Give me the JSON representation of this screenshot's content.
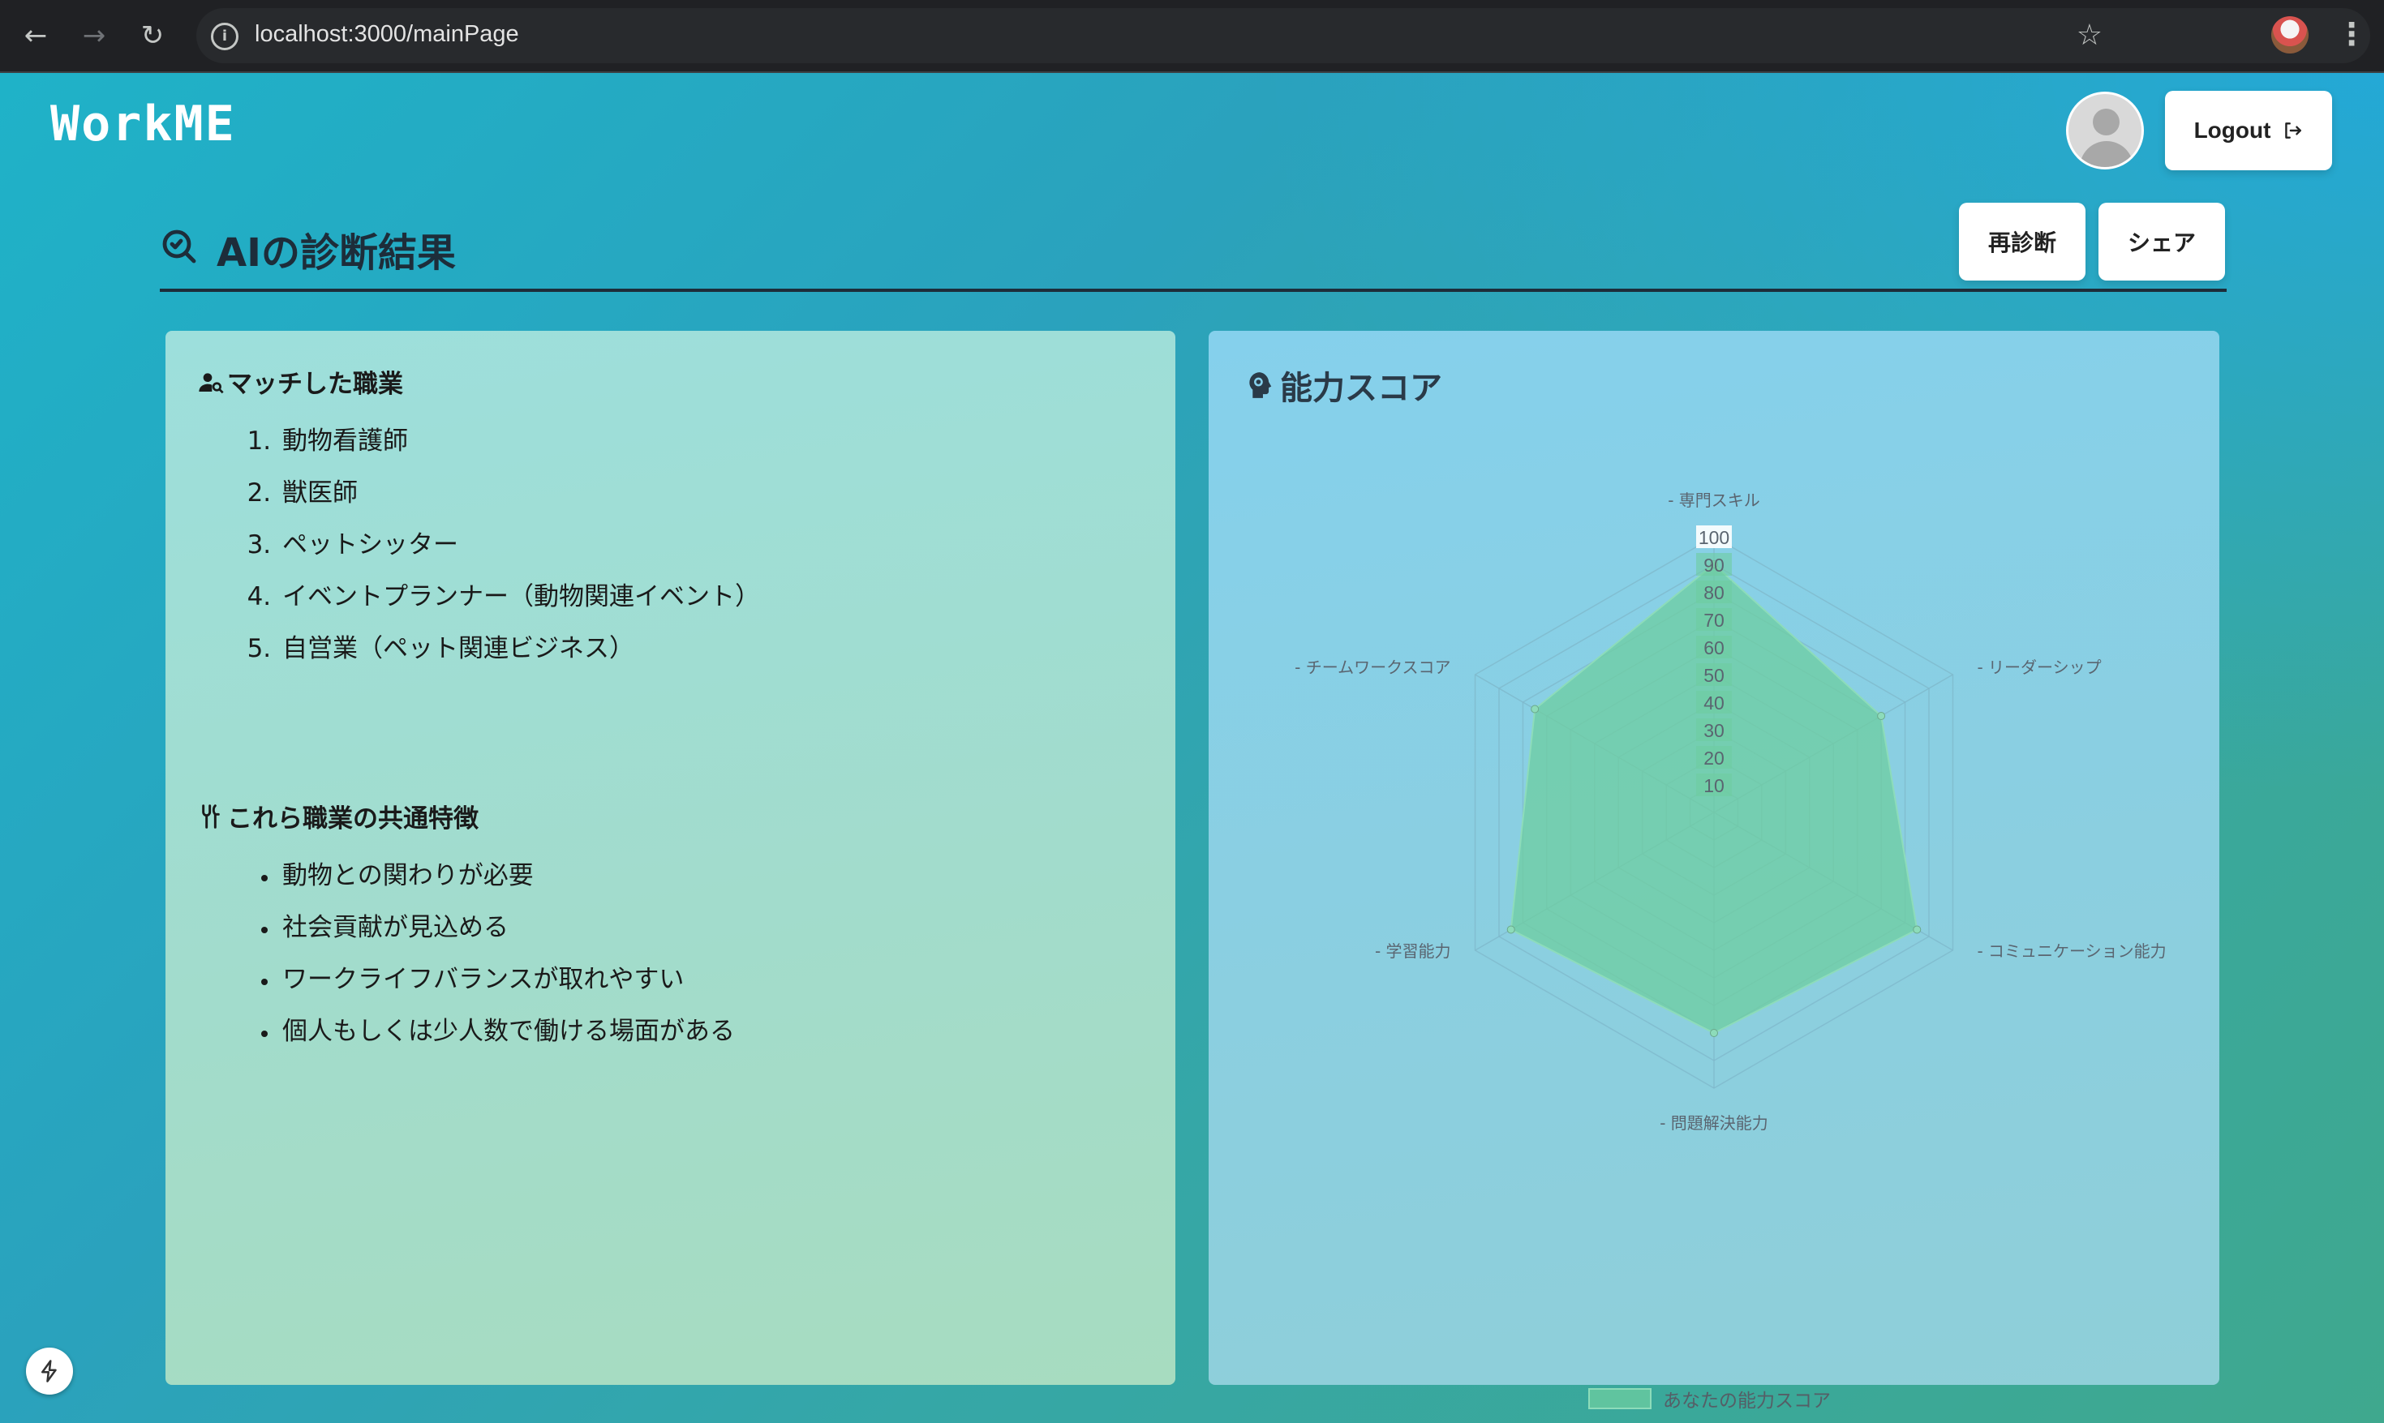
{
  "browser": {
    "url": "localhost:3000/mainPage",
    "back_icon": "arrow-left-icon",
    "forward_icon": "arrow-right-icon",
    "reload_icon": "reload-icon",
    "bookmark_icon": "star-icon",
    "menu_icon": "vertical-dots-icon"
  },
  "header": {
    "brand": "WorkME",
    "logout_label": "Logout"
  },
  "section": {
    "title": "AIの診断結果",
    "rediagnose_label": "再診断",
    "share_label": "シェア"
  },
  "matched": {
    "title": "マッチした職業",
    "jobs": [
      "動物看護師",
      "獣医師",
      "ペットシッター",
      "イベントプランナー（動物関連イベント）",
      "自営業（ペット関連ビジネス）"
    ]
  },
  "features": {
    "title": "これら職業の共通特徴",
    "items": [
      "動物との関わりが必要",
      "社会貢献が見込める",
      "ワークライフバランスが取れやすい",
      "個人もしくは少人数で働ける場面がある"
    ]
  },
  "score": {
    "title": "能力スコア"
  },
  "chart_data": {
    "type": "radar",
    "categories": [
      "- 専門スキル",
      "- リーダーシップ",
      "- コミュニケーション能力",
      "- 問題解決能力",
      "- 学習能力",
      "- チームワークスコア"
    ],
    "series": [
      {
        "name": "あなたの能力スコア",
        "values": [
          90,
          70,
          85,
          80,
          85,
          75
        ]
      }
    ],
    "ticks": [
      "10",
      "20",
      "30",
      "40",
      "50",
      "60",
      "70",
      "80",
      "90",
      "100"
    ],
    "rlim": [
      0,
      100
    ],
    "legend": "bottom",
    "fill_color": "#6ecda0",
    "grid_color": "#7fb9cc"
  },
  "colors": {
    "accent_dark": "#1d2d3a"
  }
}
